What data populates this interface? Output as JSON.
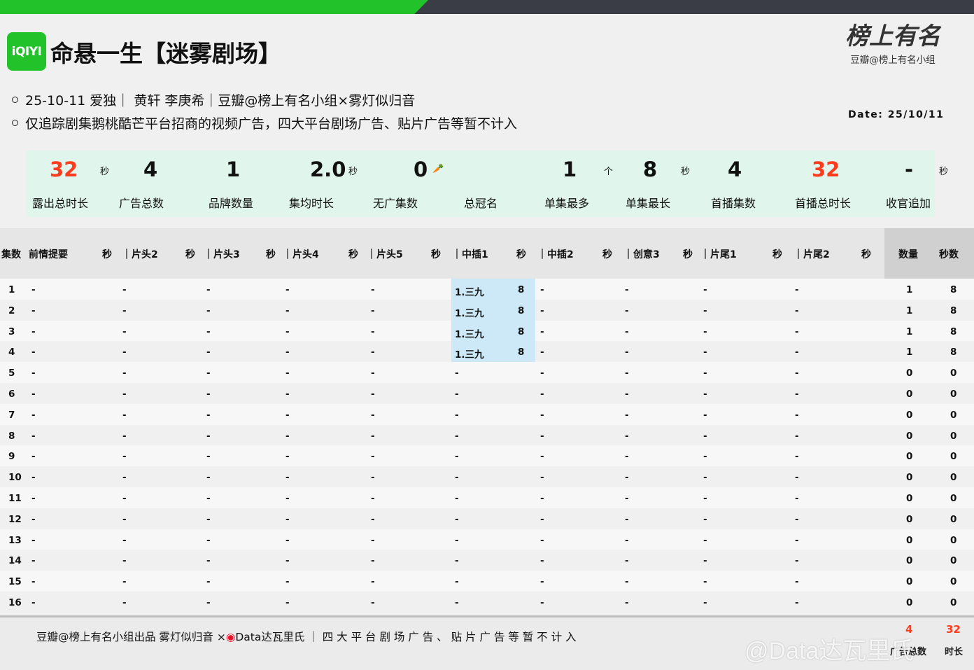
{
  "header": {
    "logo_text": "iQIYI",
    "title": "命悬一生【迷雾剧场】",
    "brand_script": "榜上有名",
    "brand_sub": "豆瓣@榜上有名小组",
    "meta_line1": "25-10-11 爱独｜ 黄轩 李庚希｜豆瓣@榜上有名小组×雾灯似归音",
    "meta_line2": "仅追踪剧集鹅桃酷芒平台招商的视频广告，四大平台剧场广告、贴片广告等暂不计入",
    "date": "Date: 25/10/11"
  },
  "stats": [
    {
      "value": "32",
      "unit": "秒",
      "label": "露出总时长",
      "red": true
    },
    {
      "value": "4",
      "unit": "",
      "label": "广告总数"
    },
    {
      "value": "1",
      "unit": "",
      "label": "品牌数量"
    },
    {
      "value": "2.0",
      "unit": "秒",
      "label": "集均时长"
    },
    {
      "value": "0",
      "unit": "🥕",
      "label": "无广集数"
    },
    {
      "value": "",
      "unit": "",
      "label": "总冠名"
    },
    {
      "value": "1",
      "unit": "个",
      "label": "单集最多"
    },
    {
      "value": "8",
      "unit": "秒",
      "label": "单集最长"
    },
    {
      "value": "4",
      "unit": "",
      "label": "首播集数"
    },
    {
      "value": "32",
      "unit": "",
      "label": "首播总时长",
      "red": true
    },
    {
      "value": "-",
      "unit": "秒",
      "label": "收官追加"
    }
  ],
  "columns": {
    "ep": "集数",
    "c1": "前情提要",
    "s": "秒",
    "c2": "｜片头2",
    "c3": "｜片头3",
    "c4": "｜片头4",
    "c5": "｜片头5",
    "c6": "｜中插1",
    "c7": "｜中插2",
    "c8": "｜创意3",
    "c9": "｜片尾1",
    "c10": "｜片尾2",
    "count": "数量",
    "secs": "秒数"
  },
  "rows": [
    {
      "ep": "1",
      "mid1": "1.三九",
      "mid1_s": "8",
      "count": "1",
      "secs": "8"
    },
    {
      "ep": "2",
      "mid1": "1.三九",
      "mid1_s": "8",
      "count": "1",
      "secs": "8"
    },
    {
      "ep": "3",
      "mid1": "1.三九",
      "mid1_s": "8",
      "count": "1",
      "secs": "8"
    },
    {
      "ep": "4",
      "mid1": "1.三九",
      "mid1_s": "8",
      "count": "1",
      "secs": "8"
    },
    {
      "ep": "5",
      "mid1": "-",
      "mid1_s": "",
      "count": "0",
      "secs": "0"
    },
    {
      "ep": "6",
      "mid1": "-",
      "mid1_s": "",
      "count": "0",
      "secs": "0"
    },
    {
      "ep": "7",
      "mid1": "-",
      "mid1_s": "",
      "count": "0",
      "secs": "0"
    },
    {
      "ep": "8",
      "mid1": "-",
      "mid1_s": "",
      "count": "0",
      "secs": "0"
    },
    {
      "ep": "9",
      "mid1": "-",
      "mid1_s": "",
      "count": "0",
      "secs": "0"
    },
    {
      "ep": "10",
      "mid1": "-",
      "mid1_s": "",
      "count": "0",
      "secs": "0"
    },
    {
      "ep": "11",
      "mid1": "-",
      "mid1_s": "",
      "count": "0",
      "secs": "0"
    },
    {
      "ep": "12",
      "mid1": "-",
      "mid1_s": "",
      "count": "0",
      "secs": "0"
    },
    {
      "ep": "13",
      "mid1": "-",
      "mid1_s": "",
      "count": "0",
      "secs": "0"
    },
    {
      "ep": "14",
      "mid1": "-",
      "mid1_s": "",
      "count": "0",
      "secs": "0"
    },
    {
      "ep": "15",
      "mid1": "-",
      "mid1_s": "",
      "count": "0",
      "secs": "0"
    },
    {
      "ep": "16",
      "mid1": "-",
      "mid1_s": "",
      "count": "0",
      "secs": "0"
    }
  ],
  "empty_mark": "-",
  "footer": {
    "text": "豆瓣@榜上有名小组出品  雾灯似归音 ×",
    "text2": "Data达瓦里氏 ｜ 四 大 平 台 剧 场 广 告 、 贴 片 广 告 等 暂 不 计 入",
    "total_count": "4",
    "total_secs": "32",
    "label_count": "广告总数",
    "label_secs": "时长",
    "watermark": "@Data达瓦里氏"
  },
  "colors": {
    "accent_green": "#22c22a",
    "highlight_red": "#ff3b1e",
    "cell_highlight": "#cde9f7",
    "stats_bg": "#e0f5ec"
  }
}
